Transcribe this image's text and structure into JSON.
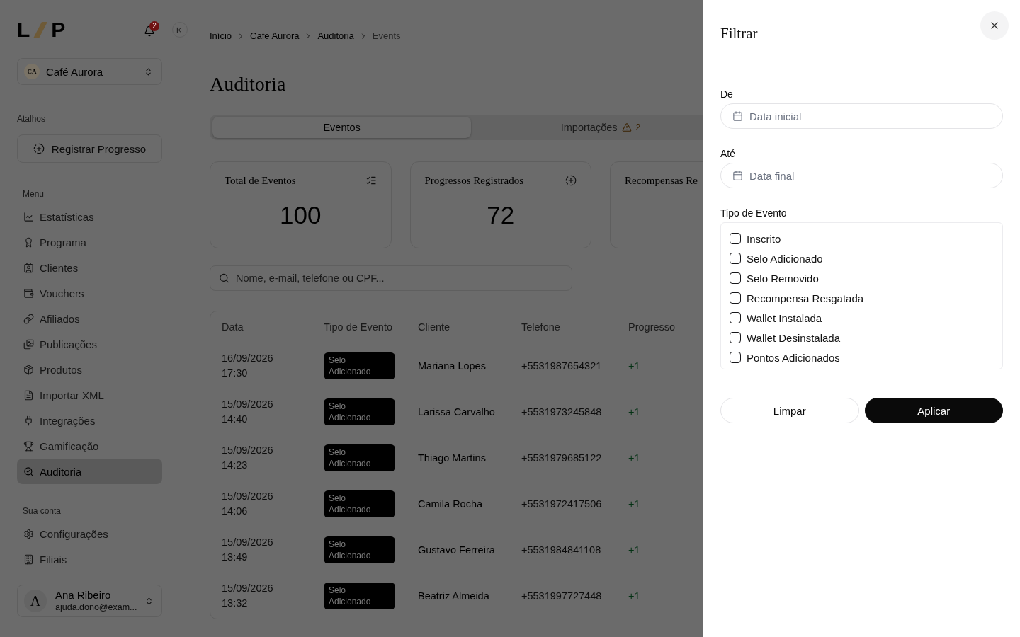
{
  "sidebar": {
    "logo": {
      "letters": [
        "L",
        "P"
      ]
    },
    "notifications": {
      "count": "2"
    },
    "workspace": {
      "initials": "CA",
      "name": "Café Aurora"
    },
    "shortcuts": {
      "title": "Atalhos",
      "items": [
        {
          "label": "Registrar Progresso"
        }
      ]
    },
    "menu": {
      "title": "Menu",
      "items": [
        {
          "label": "Estatísticas",
          "selected": false
        },
        {
          "label": "Programa",
          "selected": false
        },
        {
          "label": "Clientes",
          "selected": false
        },
        {
          "label": "Vouchers",
          "selected": false
        },
        {
          "label": "Afiliados",
          "selected": false
        },
        {
          "label": "Publicações",
          "selected": false
        },
        {
          "label": "Produtos",
          "selected": false
        },
        {
          "label": "Importar XML",
          "selected": false
        },
        {
          "label": "Integrações",
          "selected": false
        },
        {
          "label": "Gamificação",
          "selected": false
        },
        {
          "label": "Auditoria",
          "selected": true
        }
      ]
    },
    "account": {
      "title": "Sua conta",
      "items": [
        {
          "label": "Configurações",
          "selected": false
        },
        {
          "label": "Filiais",
          "selected": false
        }
      ]
    },
    "user": {
      "initial": "A",
      "name": "Ana Ribeiro",
      "email": "ajuda.dono@exam..."
    }
  },
  "breadcrumb": [
    {
      "label": "Início",
      "current": false
    },
    {
      "label": "Cafe Aurora",
      "current": false
    },
    {
      "label": "Auditoria",
      "current": false
    },
    {
      "label": "Events",
      "current": true
    }
  ],
  "page_title": "Auditoria",
  "tabs": [
    {
      "label": "Eventos",
      "selected": true
    },
    {
      "label": "Importações",
      "selected": false,
      "warning_count": "2"
    }
  ],
  "stats": [
    {
      "title": "Total de Eventos",
      "value": "100"
    },
    {
      "title": "Progressos Registrados",
      "value": "72"
    },
    {
      "title": "Recompensas Re"
    }
  ],
  "search": {
    "placeholder": "Nome, e-mail, telefone ou CPF..."
  },
  "table": {
    "columns": [
      "Data",
      "Tipo de Evento",
      "Cliente",
      "Telefone",
      "Progresso"
    ],
    "rows": [
      {
        "date": "16/09/2026",
        "time": "17:30",
        "event_type": "Selo Adicionado",
        "client": "Mariana Lopes",
        "phone": "+5531987654321",
        "progress": "+1"
      },
      {
        "date": "15/09/2026",
        "time": "14:40",
        "event_type": "Selo Adicionado",
        "client": "Larissa Carvalho",
        "phone": "+5531973245848",
        "progress": "+1"
      },
      {
        "date": "15/09/2026",
        "time": "14:23",
        "event_type": "Selo Adicionado",
        "client": "Thiago Martins",
        "phone": "+5531979685122",
        "progress": "+1"
      },
      {
        "date": "15/09/2026",
        "time": "14:06",
        "event_type": "Selo Adicionado",
        "client": "Camila Rocha",
        "phone": "+5531972417506",
        "progress": "+1"
      },
      {
        "date": "15/09/2026",
        "time": "13:49",
        "event_type": "Selo Adicionado",
        "client": "Gustavo Ferreira",
        "phone": "+5531984841108",
        "progress": "+1"
      },
      {
        "date": "15/09/2026",
        "time": "13:32",
        "event_type": "Selo Adicionado",
        "client": "Beatriz Almeida",
        "phone": "+5531997727448",
        "progress": "+1"
      }
    ]
  },
  "filter_drawer": {
    "title": "Filtrar",
    "fields": [
      {
        "label": "De",
        "placeholder": "Data inicial"
      },
      {
        "label": "Até",
        "placeholder": "Data final"
      }
    ],
    "event_types": {
      "label": "Tipo de Evento",
      "options": [
        {
          "label": "Inscrito",
          "checked": false
        },
        {
          "label": "Selo Adicionado",
          "checked": false
        },
        {
          "label": "Selo Removido",
          "checked": false
        },
        {
          "label": "Recompensa Resgatada",
          "checked": false
        },
        {
          "label": "Wallet Instalada",
          "checked": false
        },
        {
          "label": "Wallet Desinstalada",
          "checked": false
        },
        {
          "label": "Pontos Adicionados",
          "checked": false
        }
      ]
    },
    "buttons": [
      {
        "label": "Limpar",
        "kind": "secondary"
      },
      {
        "label": "Aplicar",
        "kind": "primary"
      }
    ]
  }
}
